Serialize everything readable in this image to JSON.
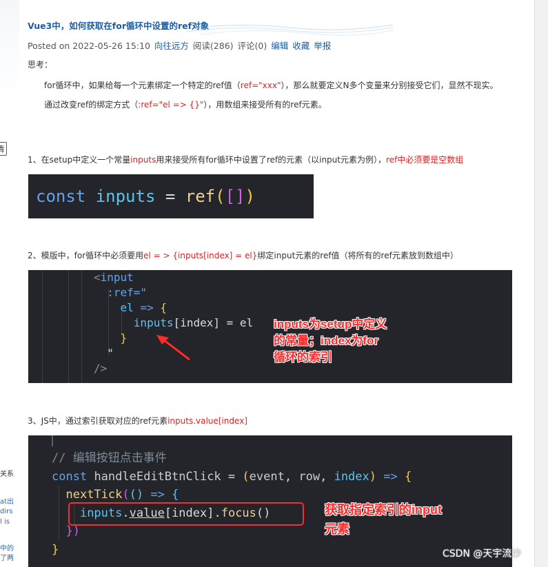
{
  "post": {
    "title": "Vue3中，如何获取在for循环中设置的ref对象",
    "meta": {
      "posted": "Posted on 2022-05-26 15:10",
      "author": "向往远方",
      "reads": "阅读(286)",
      "comments": "评论(0)",
      "edit": "编辑",
      "favorite": "收藏",
      "report": "举报"
    },
    "think_label": "思考：",
    "para1_a": "for循环中，如果给每一个元素绑定一个特定的ref值（",
    "para1_red": "ref=\"xxx\"",
    "para1_b": "），那么就要定义N多个变量来分别接受它们，显然不现实。",
    "para2_a": "通过改变ref的绑定方式（",
    "para2_red": ":ref=\"el => {}\"",
    "para2_b": "），用数组来接受所有的ref元素。",
    "step1_a": "1、在setup中定义一个常量",
    "step1_red1": "inputs",
    "step1_b": "用来接受所有for循环中设置了ref的元素（以input元素为例），",
    "step1_red2": "ref中必须要是空数组",
    "step2_a": "2、模版中，for循环中必须要用",
    "step2_red": "el = > {inputs[index] = el}",
    "step2_b": "绑定input元素的ref值（将所有的ref元素放到数组中）",
    "step3_a": "3、JS中，通过索引获取对应的ref元素",
    "step3_red": "inputs.value[index]"
  },
  "code1": {
    "kw": "const",
    "var": "inputs",
    "eq": "=",
    "fn": "ref",
    "p1": "(",
    "b1": "[",
    "b2": "]",
    "p2": ")"
  },
  "code2": {
    "l1_lt": "<",
    "l1_tag": "input",
    "l2": ":ref=\"",
    "l3_el": "el",
    "l3_arrow": "=>",
    "l3_brace": "{",
    "l4_var": "inputs",
    "l4_idx": "[index]",
    "l4_rest": " = el",
    "l5": "}",
    "l6": "\"",
    "l7": "/>"
  },
  "code3": {
    "comment": "// 编辑按钮点击事件",
    "l2_kw": "const",
    "l2_name": "handleEditBtnClick",
    "l2_eq": "=",
    "l2_p1": "(",
    "l2_a1": "event",
    "l2_c1": ",",
    "l2_a2": "row",
    "l2_c2": ",",
    "l2_a3": "index",
    "l2_p2": ")",
    "l2_arrow": "=>",
    "l2_brace": "{",
    "l3_fn": "nextTick",
    "l3_p": "(",
    "l3_pp": "()",
    "l3_arrow": "=>",
    "l3_brace": "{",
    "l4_var": "inputs",
    "l4_dot1": ".",
    "l4_value": "value",
    "l4_idx": "[index]",
    "l4_dot2": ".",
    "l4_fn": "focus",
    "l4_call": "()",
    "l5": "})",
    "l6": "}"
  },
  "annotations": {
    "a1_line1": "inputs为setup中定义",
    "a1_line2": "的常量；index为for",
    "a1_line3": "循环的索引",
    "a2_line1": "获取指定索引的input",
    "a2_line2": "元素"
  },
  "watermark": "CSDN @天宇流沙",
  "sidebar_fragments": {
    "btn": "青",
    "t1": "关系",
    "t2": "at出",
    "t3": "dirs",
    "t4": "l is",
    "t5": "中的",
    "t6": "了两"
  },
  "colors": {
    "code_bg": "#23252b",
    "keyword": "#63a3e8",
    "variable": "#5cc4ee",
    "function": "#f0d28a",
    "bracket_yellow": "#f2cc3d",
    "bracket_pink": "#d55fde",
    "comment": "#7c8a97",
    "annotation_red": "#ff2a2a",
    "link_blue": "#1a5ea8"
  }
}
